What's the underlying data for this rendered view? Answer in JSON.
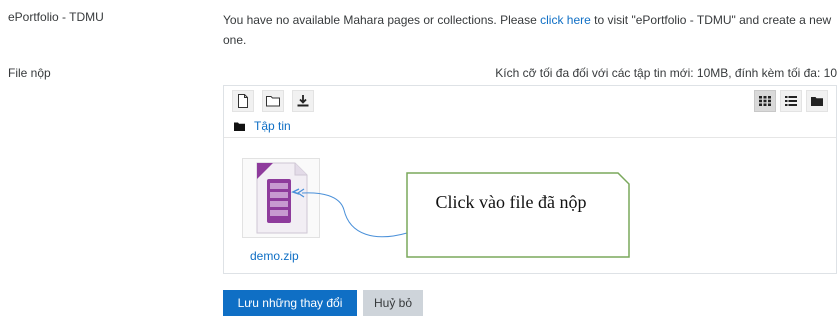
{
  "eportfolio": {
    "label": "ePortfolio - TDMU",
    "message_before": "You have no available Mahara pages or collections. Please ",
    "link_text": "click here",
    "message_after": " to visit \"ePortfolio - TDMU\" and create a new one."
  },
  "file_submission": {
    "label": "File nộp",
    "limit_text": "Kích cỡ tối đa đối với các tập tin mới: 10MB, đính kèm tối đa: 10"
  },
  "file_manager": {
    "toolbar_left_icons": [
      "new-file-icon",
      "new-folder-icon",
      "download-icon"
    ],
    "toolbar_right_icons": [
      "grid-view-icon",
      "list-view-icon",
      "tree-view-icon"
    ],
    "active_view": "grid-view-icon",
    "path_label": "Tập tin",
    "files": [
      {
        "name": "demo.zip",
        "icon": "zip-file-icon"
      }
    ]
  },
  "annotation": {
    "text": "Click vào file đã nộp"
  },
  "buttons": {
    "save": "Lưu những thay đổi",
    "cancel": "Huỷ bỏ"
  },
  "colors": {
    "link": "#0f6fc5",
    "primary": "#0f6fc5",
    "secondary": "#ced4da",
    "callout_border": "#7aa85c",
    "arrow": "#4a90d9",
    "zip_purple": "#8e3b9c"
  }
}
